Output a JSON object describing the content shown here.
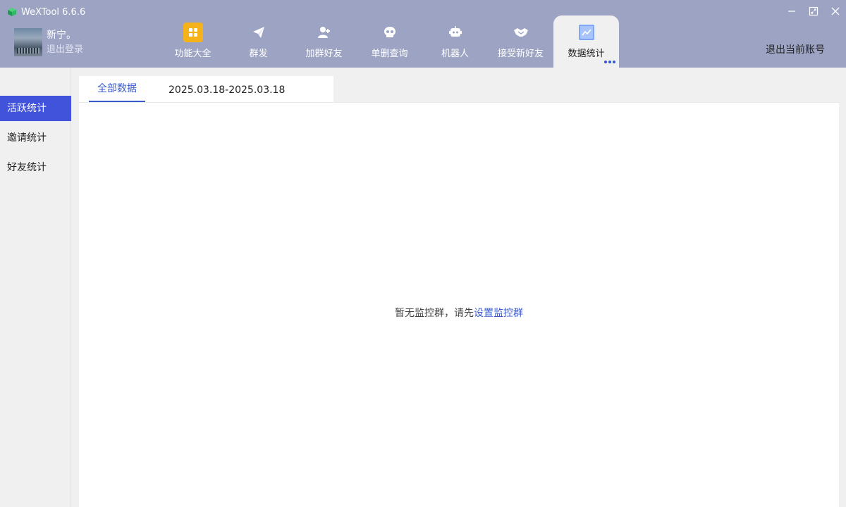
{
  "window": {
    "title": "WeXTool 6.6.6",
    "controls": [
      "minimize-icon",
      "maximize-icon",
      "close-icon"
    ]
  },
  "user": {
    "name": "新宁。",
    "logout_label": "退出登录"
  },
  "nav": {
    "items": [
      {
        "label": "功能大全",
        "icon": "grid-icon"
      },
      {
        "label": "群发",
        "icon": "send-icon"
      },
      {
        "label": "加群好友",
        "icon": "add-user-icon"
      },
      {
        "label": "单删查询",
        "icon": "skull-icon"
      },
      {
        "label": "机器人",
        "icon": "robot-icon"
      },
      {
        "label": "接受新好友",
        "icon": "handshake-icon"
      },
      {
        "label": "数据统计",
        "icon": "chart-icon",
        "active": true
      }
    ],
    "more_icon": "more-dots-icon"
  },
  "header": {
    "switch_account_label": "退出当前账号"
  },
  "sidebar": {
    "items": [
      {
        "label": "活跃统计",
        "active": true
      },
      {
        "label": "邀请统计"
      },
      {
        "label": "好友统计"
      }
    ]
  },
  "main": {
    "tab_label": "全部数据",
    "date_range": "2025.03.18-2025.03.18",
    "empty_text": "暂无监控群，请先",
    "empty_link": "设置监控群"
  },
  "colors": {
    "header_bg": "#9da3c2",
    "accent": "#4152db",
    "link": "#3a5bd0",
    "grid_icon_bg": "#f5b21b"
  }
}
